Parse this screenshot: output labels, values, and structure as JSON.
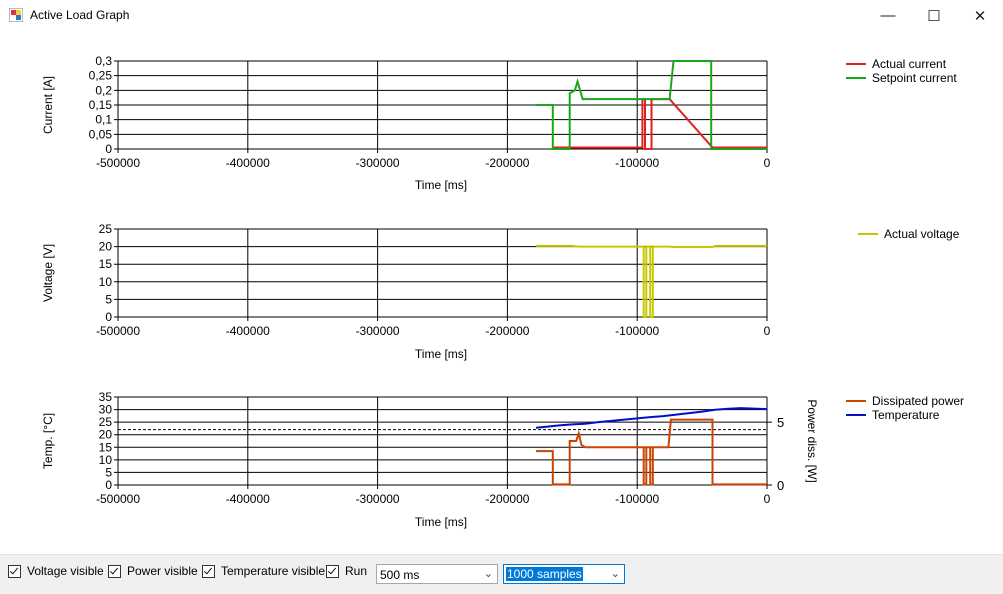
{
  "window": {
    "title": "Active Load Graph",
    "minimize_icon": "minimize-icon",
    "maximize_icon": "maximize-icon",
    "close_icon": "close-icon"
  },
  "charts": [
    {
      "type": "line",
      "ylabel": "Current [A]",
      "xlabel": "Time [ms]",
      "xlim": [
        -500000,
        0
      ],
      "ylim": [
        0,
        0.3
      ],
      "yticks": [
        "0",
        "0,05",
        "0,1",
        "0,15",
        "0,2",
        "0,25",
        "0,3"
      ],
      "xticks": [
        "-500000",
        "-400000",
        "-300000",
        "-200000",
        "-100000",
        "0"
      ],
      "legend": "right",
      "series": [
        {
          "name": "Actual current",
          "color": "#e02020",
          "points": [
            [
              -165000,
              0.005
            ],
            [
              -152000,
              0.005
            ],
            [
              -96000,
              0.005
            ],
            [
              -96000,
              0.17
            ],
            [
              -94000,
              0.17
            ],
            [
              -94000,
              0.0
            ],
            [
              -89000,
              0.0
            ],
            [
              -89000,
              0.17
            ],
            [
              -75000,
              0.17
            ],
            [
              -42000,
              0.005
            ],
            [
              0,
              0.005
            ]
          ]
        },
        {
          "name": "Setpoint current",
          "color": "#1aa81a",
          "points": [
            [
              -178000,
              0.15
            ],
            [
              -165000,
              0.15
            ],
            [
              -165000,
              0.0
            ],
            [
              -152000,
              0.0
            ],
            [
              -152000,
              0.19
            ],
            [
              -148000,
              0.2
            ],
            [
              -146000,
              0.23
            ],
            [
              -142000,
              0.17
            ],
            [
              -75000,
              0.17
            ],
            [
              -72000,
              0.3
            ],
            [
              -43000,
              0.3
            ],
            [
              -43000,
              0.0
            ],
            [
              0,
              0.0
            ]
          ]
        }
      ]
    },
    {
      "type": "line",
      "ylabel": "Voltage [V]",
      "xlabel": "Time [ms]",
      "xlim": [
        -500000,
        0
      ],
      "ylim": [
        0,
        25
      ],
      "yticks": [
        "0",
        "5",
        "10",
        "15",
        "20",
        "25"
      ],
      "xticks": [
        "-500000",
        "-400000",
        "-300000",
        "-200000",
        "-100000",
        "0"
      ],
      "legend": "right",
      "series": [
        {
          "name": "Actual voltage",
          "color": "#c8c800",
          "points": [
            [
              -178000,
              20.2
            ],
            [
              -150000,
              20.2
            ],
            [
              -145000,
              20.0
            ],
            [
              -95000,
              20.0
            ],
            [
              -95000,
              0.0
            ],
            [
              -93000,
              0.0
            ],
            [
              -93000,
              20.0
            ],
            [
              -90000,
              20.0
            ],
            [
              -90000,
              0.0
            ],
            [
              -88000,
              0.0
            ],
            [
              -88000,
              20.0
            ],
            [
              -75000,
              20.0
            ],
            [
              -72000,
              19.9
            ],
            [
              -42000,
              19.9
            ],
            [
              -40000,
              20.2
            ],
            [
              0,
              20.2
            ]
          ]
        }
      ]
    },
    {
      "type": "line",
      "ylabel": "Temp. [°C]",
      "y2label": "Power diss. [W]",
      "xlabel": "Time [ms]",
      "xlim": [
        -500000,
        0
      ],
      "ylim": [
        0,
        35
      ],
      "y2lim": [
        0,
        7
      ],
      "yticks": [
        "0",
        "5",
        "10",
        "15",
        "20",
        "25",
        "30",
        "35"
      ],
      "y2ticks": [
        "0",
        "5"
      ],
      "xticks": [
        "-500000",
        "-400000",
        "-300000",
        "-200000",
        "-100000",
        "0"
      ],
      "reference_line_temp": 22,
      "legend": "right",
      "series": [
        {
          "name": "Dissipated power",
          "color": "#cc4400",
          "axis": "y2",
          "points": [
            [
              -178000,
              2.7
            ],
            [
              -165000,
              2.7
            ],
            [
              -165000,
              0.05
            ],
            [
              -152000,
              0.05
            ],
            [
              -152000,
              3.5
            ],
            [
              -147000,
              3.5
            ],
            [
              -145000,
              4.1
            ],
            [
              -143000,
              3.2
            ],
            [
              -140000,
              3.0
            ],
            [
              -95000,
              3.0
            ],
            [
              -95000,
              0.05
            ],
            [
              -93000,
              0.05
            ],
            [
              -93000,
              3.0
            ],
            [
              -90000,
              3.0
            ],
            [
              -90000,
              0.05
            ],
            [
              -88000,
              0.05
            ],
            [
              -88000,
              3.0
            ],
            [
              -76000,
              3.0
            ],
            [
              -74000,
              5.2
            ],
            [
              -42000,
              5.2
            ],
            [
              -42000,
              0.05
            ],
            [
              0,
              0.05
            ]
          ]
        },
        {
          "name": "Temperature",
          "color": "#0010c8",
          "axis": "y",
          "points": [
            [
              -178000,
              22.8
            ],
            [
              -170000,
              23.2
            ],
            [
              -160000,
              23.7
            ],
            [
              -150000,
              24.1
            ],
            [
              -140000,
              24.4
            ],
            [
              -130000,
              25.0
            ],
            [
              -120000,
              25.5
            ],
            [
              -110000,
              26.0
            ],
            [
              -100000,
              26.5
            ],
            [
              -90000,
              27.0
            ],
            [
              -80000,
              27.4
            ],
            [
              -70000,
              28.0
            ],
            [
              -60000,
              28.6
            ],
            [
              -50000,
              29.2
            ],
            [
              -40000,
              29.9
            ],
            [
              -30000,
              30.3
            ],
            [
              -20000,
              30.6
            ],
            [
              -10000,
              30.4
            ],
            [
              0,
              30.2
            ]
          ]
        }
      ]
    }
  ],
  "controls": {
    "voltage_visible": "Voltage visible",
    "power_visible": "Power visible",
    "temperature_visible": "Temperature visible",
    "run": "Run",
    "interval_value": "500 ms",
    "samples_value": "1000 samples"
  }
}
